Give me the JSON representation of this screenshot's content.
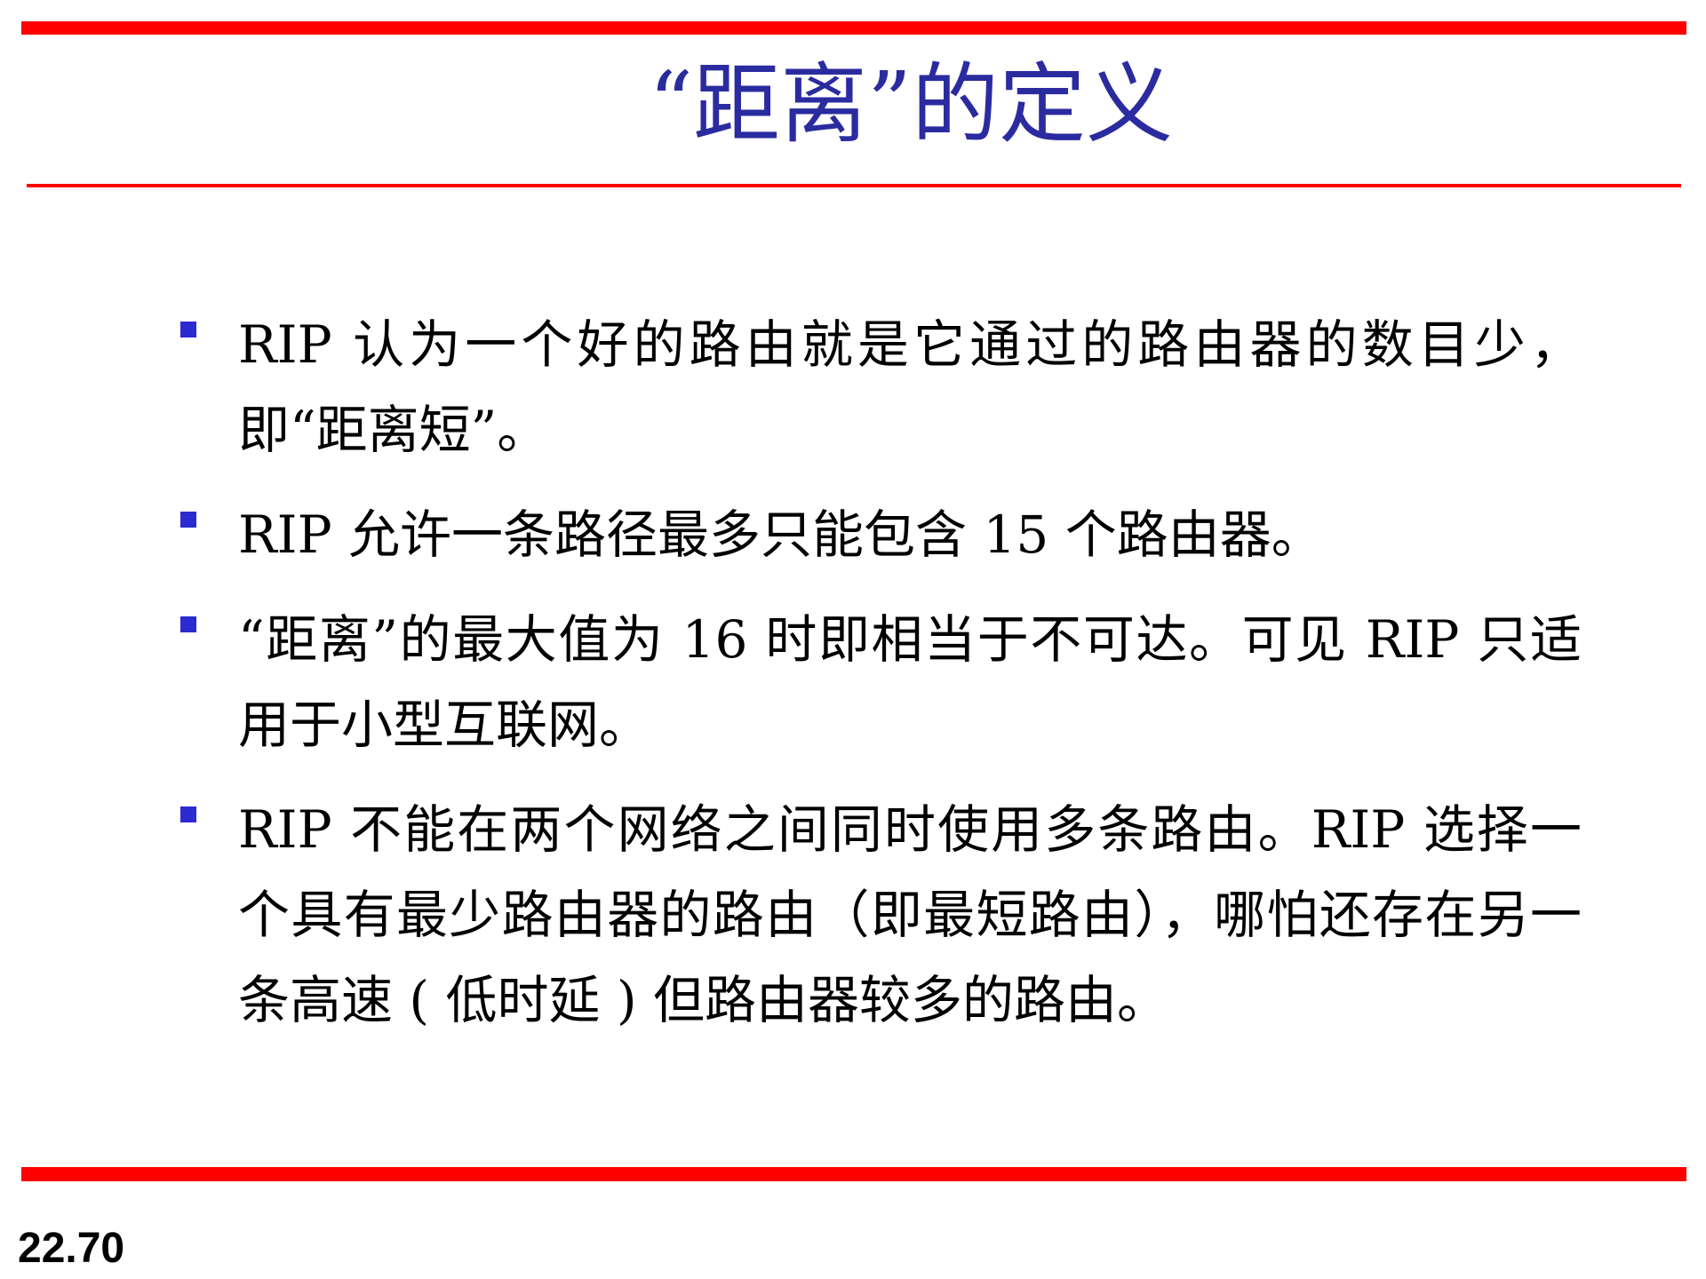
{
  "slide": {
    "title": "“距离”的定义",
    "bullets": [
      {
        "text": "RIP 认为一个好的路由就是它通过的路由器的数目少，即“距离短”。"
      },
      {
        "text": "RIP 允许一条路径最多只能包含 15 个路由器。"
      },
      {
        "text": "“距离”的最大值为 16 时即相当于不可达。可见 RIP 只适用于小型互联网。"
      },
      {
        "text": "RIP 不能在两个网络之间同时使用多条路由。RIP 选择一个具有最少路由器的路由（即最短路由），哪怕还存在另一条高速 ( 低时延 ) 但路由器较多的路由。"
      }
    ],
    "page_number": "22.70"
  },
  "colors": {
    "rule": "#ff0000",
    "title": "#2b2ba0",
    "bullet_marker": "#2b2bd0",
    "body_text": "#000000"
  }
}
